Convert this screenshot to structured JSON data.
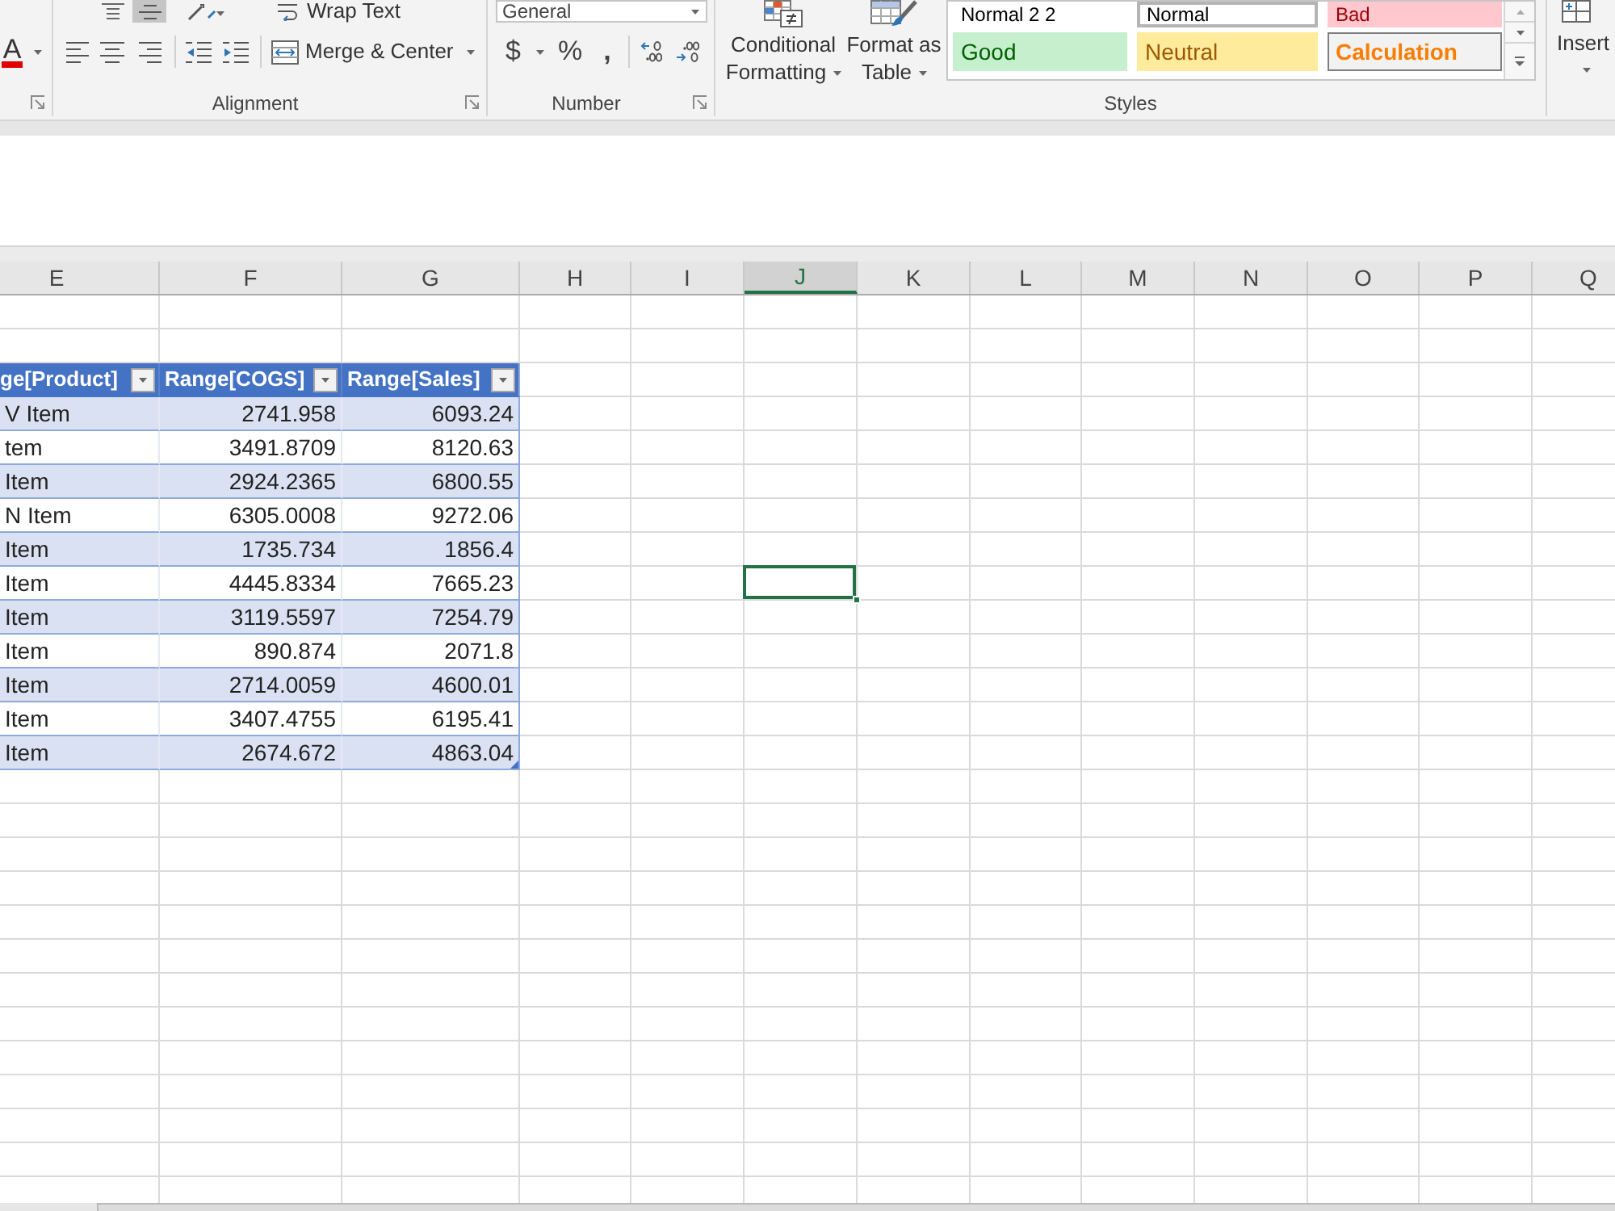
{
  "ribbon": {
    "font": {
      "font_color": "A"
    },
    "alignment": {
      "wrap_text": "Wrap Text",
      "merge_and_center": "Merge & Center",
      "label": "Alignment"
    },
    "number": {
      "format": "General",
      "currency": "$",
      "percent": "%",
      "comma": ",",
      "label": "Number"
    },
    "styles": {
      "conditional_formatting": [
        "Conditional",
        "Formatting"
      ],
      "format_as_table": [
        "Format as",
        "Table"
      ],
      "gallery": [
        {
          "label": "Normal 2 2",
          "kind": "normal",
          "selected": false
        },
        {
          "label": "Normal",
          "kind": "normal",
          "selected": true
        },
        {
          "label": "Bad",
          "kind": "bad",
          "selected": false
        },
        {
          "label": "Good",
          "kind": "good",
          "selected": false
        },
        {
          "label": "Neutral",
          "kind": "neutral",
          "selected": false
        },
        {
          "label": "Calculation",
          "kind": "calculation",
          "selected": false
        }
      ],
      "label": "Styles"
    },
    "cells": {
      "insert": "Insert"
    }
  },
  "grid": {
    "columns": [
      {
        "label": "E",
        "selected": false
      },
      {
        "label": "F",
        "selected": false
      },
      {
        "label": "G",
        "selected": false
      },
      {
        "label": "H",
        "selected": false
      },
      {
        "label": "I",
        "selected": false
      },
      {
        "label": "J",
        "selected": true
      },
      {
        "label": "K",
        "selected": false
      },
      {
        "label": "L",
        "selected": false
      },
      {
        "label": "M",
        "selected": false
      },
      {
        "label": "N",
        "selected": false
      },
      {
        "label": "O",
        "selected": false
      },
      {
        "label": "P",
        "selected": false
      },
      {
        "label": "Q",
        "selected": false
      }
    ],
    "rows": [
      {
        "selected": false
      },
      {
        "selected": false
      },
      {
        "selected": false
      },
      {
        "selected": false
      },
      {
        "selected": false
      },
      {
        "selected": false
      },
      {
        "selected": false
      },
      {
        "selected": false
      },
      {
        "selected": true
      },
      {
        "selected": false
      },
      {
        "selected": false
      },
      {
        "selected": false
      },
      {
        "selected": false
      },
      {
        "selected": false
      },
      {
        "selected": false
      },
      {
        "selected": false
      },
      {
        "selected": false
      },
      {
        "selected": false
      },
      {
        "selected": false
      },
      {
        "selected": false
      },
      {
        "selected": false
      },
      {
        "selected": false
      },
      {
        "selected": false
      },
      {
        "selected": false
      },
      {
        "selected": false
      },
      {
        "selected": false
      },
      {
        "selected": false
      }
    ]
  },
  "table": {
    "columns": [
      "ge[Product]",
      "Range[COGS]",
      "Range[Sales]"
    ],
    "rows": [
      [
        "V Item",
        "2741.958",
        "6093.24"
      ],
      [
        "tem",
        "3491.8709",
        "8120.63"
      ],
      [
        "Item",
        "2924.2365",
        "6800.55"
      ],
      [
        "N Item",
        "6305.0008",
        "9272.06"
      ],
      [
        "Item",
        "1735.734",
        "1856.4"
      ],
      [
        "Item",
        "4445.8334",
        "7665.23"
      ],
      [
        "Item",
        "3119.5597",
        "7254.79"
      ],
      [
        "Item",
        "890.874",
        "2071.8"
      ],
      [
        "Item",
        "2714.0059",
        "4600.01"
      ],
      [
        "Item",
        "3407.4755",
        "6195.41"
      ],
      [
        "Item",
        "2674.672",
        "4863.04"
      ]
    ]
  }
}
